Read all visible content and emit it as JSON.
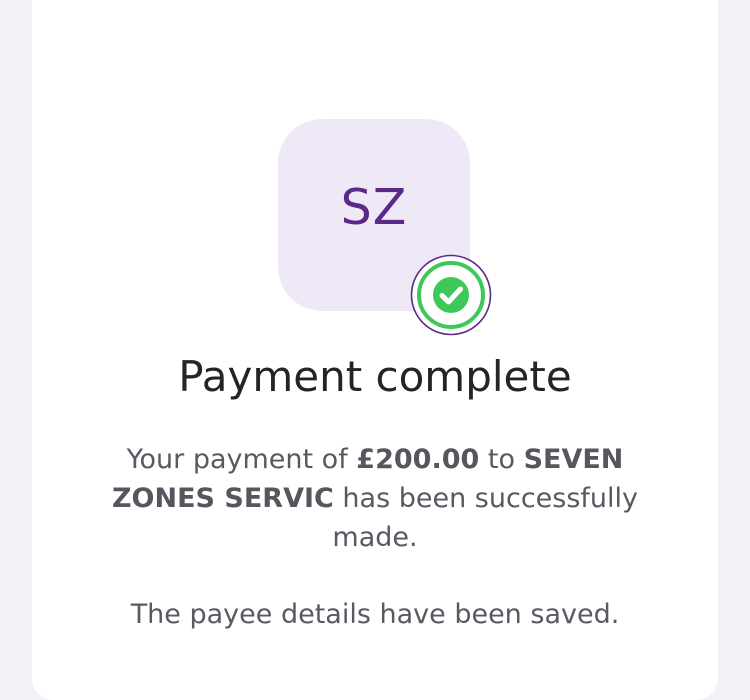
{
  "payee": {
    "initials": "SZ"
  },
  "status": {
    "icon": "check-circle-icon",
    "color": "#3fc85a"
  },
  "title": "Payment complete",
  "message": {
    "prefix": "Your payment of ",
    "amount": "£200.00",
    "middle": " to ",
    "payee_name": "SEVEN ZONES SERVIC",
    "suffix": " has been successfully made."
  },
  "saved_note": "The payee details have been saved.",
  "colors": {
    "background": "#f3f1f7",
    "card": "#ffffff",
    "avatar_bg": "#efe8f7",
    "avatar_text": "#5a2a86",
    "badge_ring": "#5a2a86",
    "success": "#3fc85a"
  }
}
